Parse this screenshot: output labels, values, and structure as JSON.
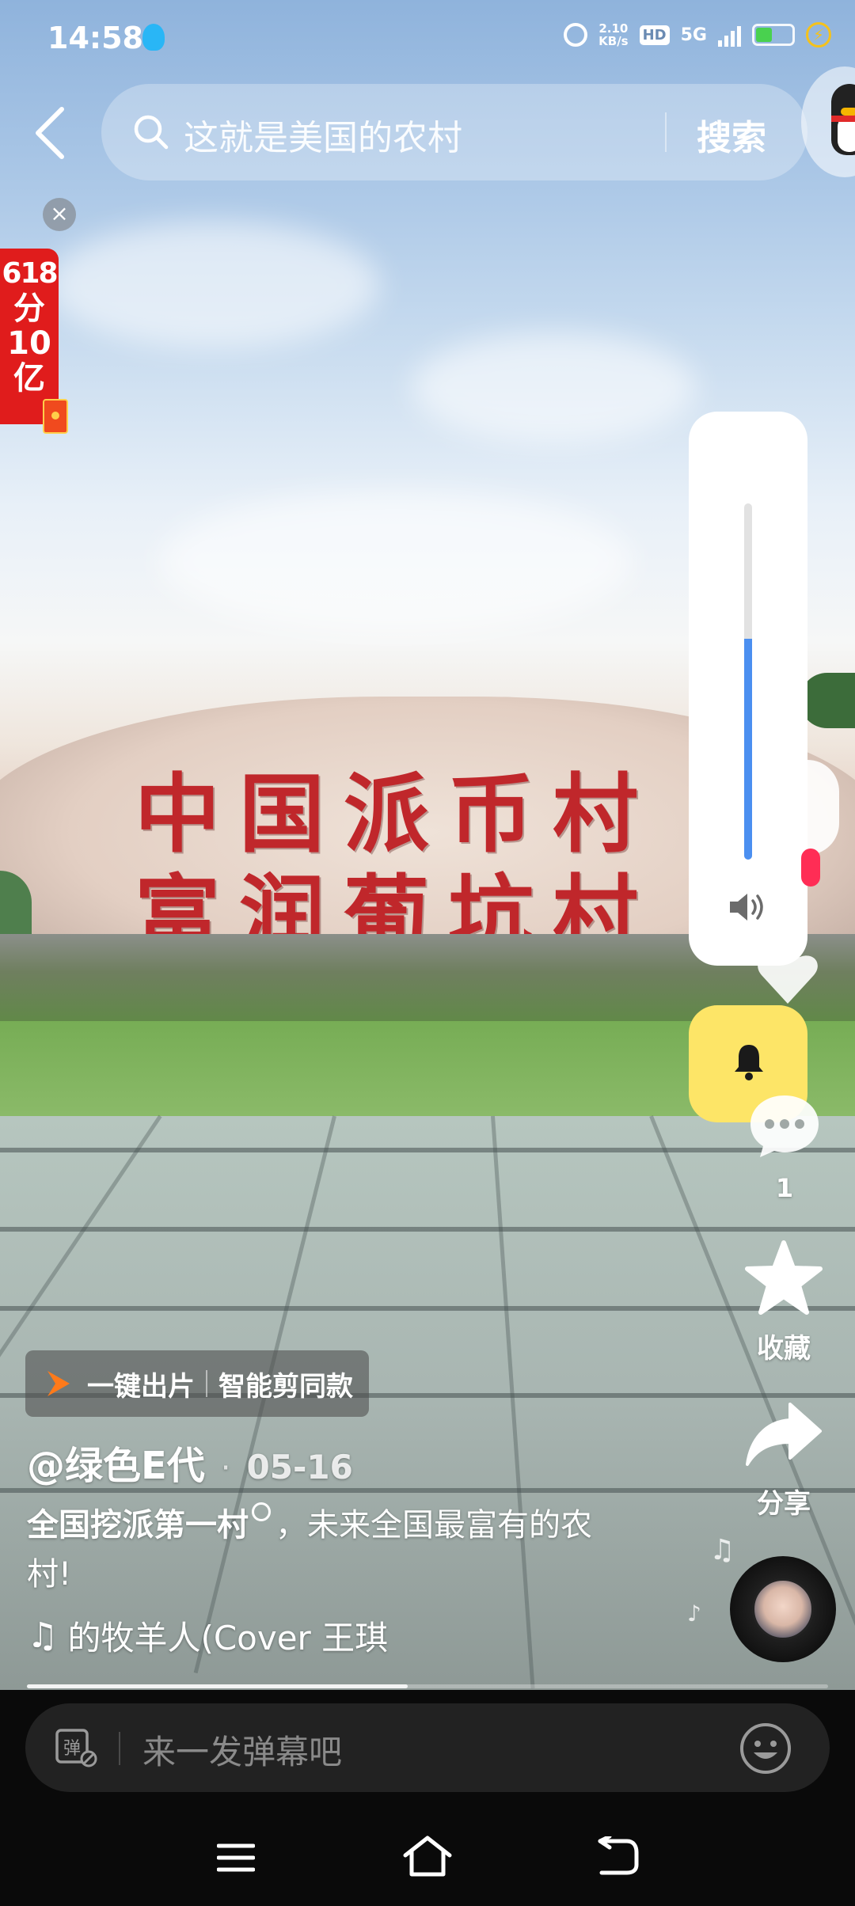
{
  "status_bar": {
    "time": "14:58",
    "net_speed_value": "2.10",
    "net_speed_unit": "KB/s",
    "hd_label": "HD",
    "network_label": "5G",
    "battery_level": 0.45
  },
  "search": {
    "query": "这就是美国的农村",
    "button_label": "搜索"
  },
  "promo": {
    "line1": "618",
    "line2": "分",
    "line3": "10",
    "line4": "亿",
    "close_glyph": "×"
  },
  "video": {
    "stone_text": "中国派币村\n富润葡坑村"
  },
  "volume": {
    "level": 0.62
  },
  "actions": {
    "comment_count": "1",
    "favorite_label": "收藏",
    "share_label": "分享"
  },
  "chip": {
    "one_click_label": "一键出片",
    "template_label": "智能剪同款"
  },
  "post": {
    "author": "@绿色E代",
    "separator": "·",
    "date": "05-16",
    "caption_topic": "全国挖派第一村",
    "caption_rest": "，未来全国最富有的农村!",
    "music_note": "♫",
    "music": "的牧羊人(Cover 王琪",
    "progress": 0.475
  },
  "danmaku": {
    "placeholder": "来一发弹幕吧"
  },
  "colors": {
    "accent_blue": "#4b8ff0",
    "bell_yellow": "#fde567",
    "promo_red": "#e01c1c",
    "chip_orange": "#ff7a1a"
  },
  "icons": [
    "back-icon",
    "search-icon",
    "speaker-icon",
    "bell-icon",
    "comment-icon",
    "star-icon",
    "share-icon",
    "danmaku-toggle-icon",
    "emoji-icon",
    "menu-icon",
    "home-icon",
    "back-nav-icon"
  ]
}
